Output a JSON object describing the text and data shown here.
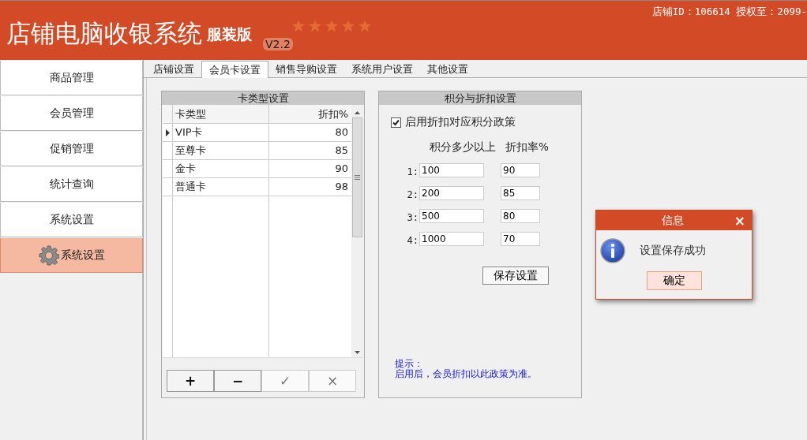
{
  "header": {
    "title": "店铺电脑收银系统",
    "edition": "服装版",
    "version": "V2.2",
    "store_info": "店铺ID：106614 授权至：2099-"
  },
  "sidebar": {
    "items": [
      {
        "label": "商品管理",
        "selected": false
      },
      {
        "label": "会员管理",
        "selected": false
      },
      {
        "label": "促销管理",
        "selected": false
      },
      {
        "label": "统计查询",
        "selected": false
      },
      {
        "label": "系统设置",
        "selected": false
      },
      {
        "label": "系统设置",
        "selected": true
      }
    ]
  },
  "tabs": [
    {
      "label": "店铺设置",
      "selected": false
    },
    {
      "label": "会员卡设置",
      "selected": true
    },
    {
      "label": "销售导购设置",
      "selected": false
    },
    {
      "label": "系统用户设置",
      "selected": false
    },
    {
      "label": "其他设置",
      "selected": false
    }
  ],
  "card_types": {
    "title": "卡类型设置",
    "columns": [
      "卡类型",
      "折扣%"
    ],
    "rows": [
      {
        "cells": [
          "VIP卡",
          "80"
        ],
        "selected": true
      },
      {
        "cells": [
          "至尊卡",
          "85"
        ],
        "selected": false
      },
      {
        "cells": [
          "金卡",
          "90"
        ],
        "selected": false
      },
      {
        "cells": [
          "普通卡",
          "98"
        ],
        "selected": false
      }
    ],
    "buttons": [
      {
        "label": "+",
        "disabled": false
      },
      {
        "label": "−",
        "disabled": false
      },
      {
        "label": "✓",
        "disabled": true
      },
      {
        "label": "×",
        "disabled": true
      }
    ]
  },
  "points_discount": {
    "title": "积分与折扣设置",
    "enable": {
      "label": "启用折扣对应积分政策",
      "checked": true
    },
    "columns": [
      "积分多少以上",
      "折扣率%"
    ],
    "rows": [
      {
        "index": "1:",
        "points": "100",
        "rate": "90"
      },
      {
        "index": "2:",
        "points": "200",
        "rate": "85"
      },
      {
        "index": "3:",
        "points": "500",
        "rate": "80"
      },
      {
        "index": "4:",
        "points": "1000",
        "rate": "70"
      }
    ],
    "save_button": "保存设置",
    "hint_title": "提示：",
    "hint": "启用后，会员折扣以此政策为准。"
  },
  "dialog": {
    "title": "信息",
    "close": "×",
    "message": "设置保存成功",
    "button": "确定"
  }
}
